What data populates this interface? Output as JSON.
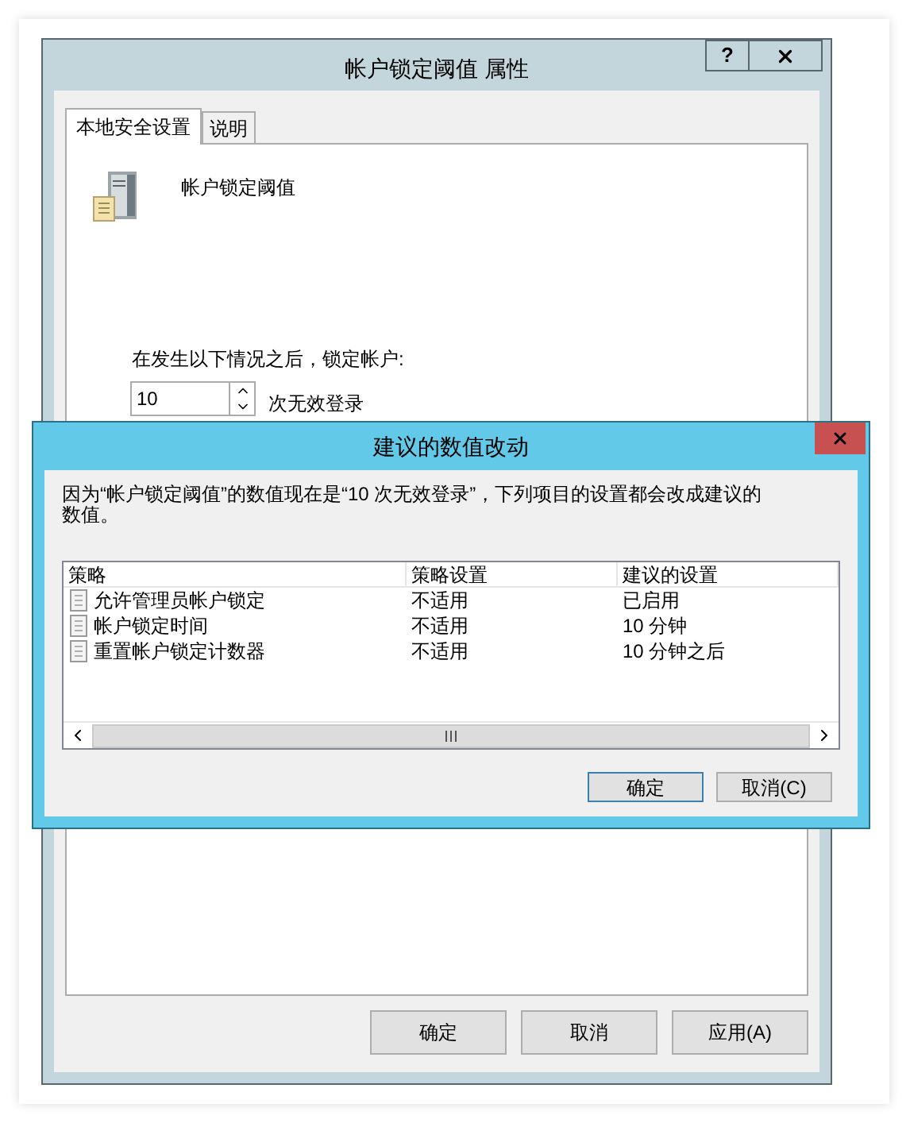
{
  "window": {
    "title": "帐户锁定阈值 属性",
    "help_button": "?"
  },
  "tabs": [
    {
      "label": "本地安全设置",
      "selected": true
    },
    {
      "label": "说明",
      "selected": false
    }
  ],
  "policy": {
    "name": "帐户锁定阈值"
  },
  "lockout": {
    "label": "在发生以下情况之后，锁定帐户:",
    "value": "10",
    "unit": "次无效登录"
  },
  "buttons": [
    "确定",
    "取消",
    "应用(A)"
  ],
  "dialog": {
    "title": "建议的数值改动",
    "message": "因为“帐户锁定阈值”的数值现在是“10 次无效登录”，下列项目的设置都会改成建议的数值。",
    "columns": [
      "策略",
      "策略设置",
      "建议的设置"
    ],
    "rows": [
      {
        "cells": [
          "允许管理员帐户锁定",
          "不适用",
          "已启用"
        ]
      },
      {
        "cells": [
          "帐户锁定时间",
          "不适用",
          "10 分钟"
        ]
      },
      {
        "cells": [
          "重置帐户锁定计数器",
          "不适用",
          "10 分钟之后"
        ]
      }
    ],
    "buttons": [
      {
        "label": "确定",
        "selected": true
      },
      {
        "label": "取消(C)",
        "selected": false
      }
    ]
  }
}
